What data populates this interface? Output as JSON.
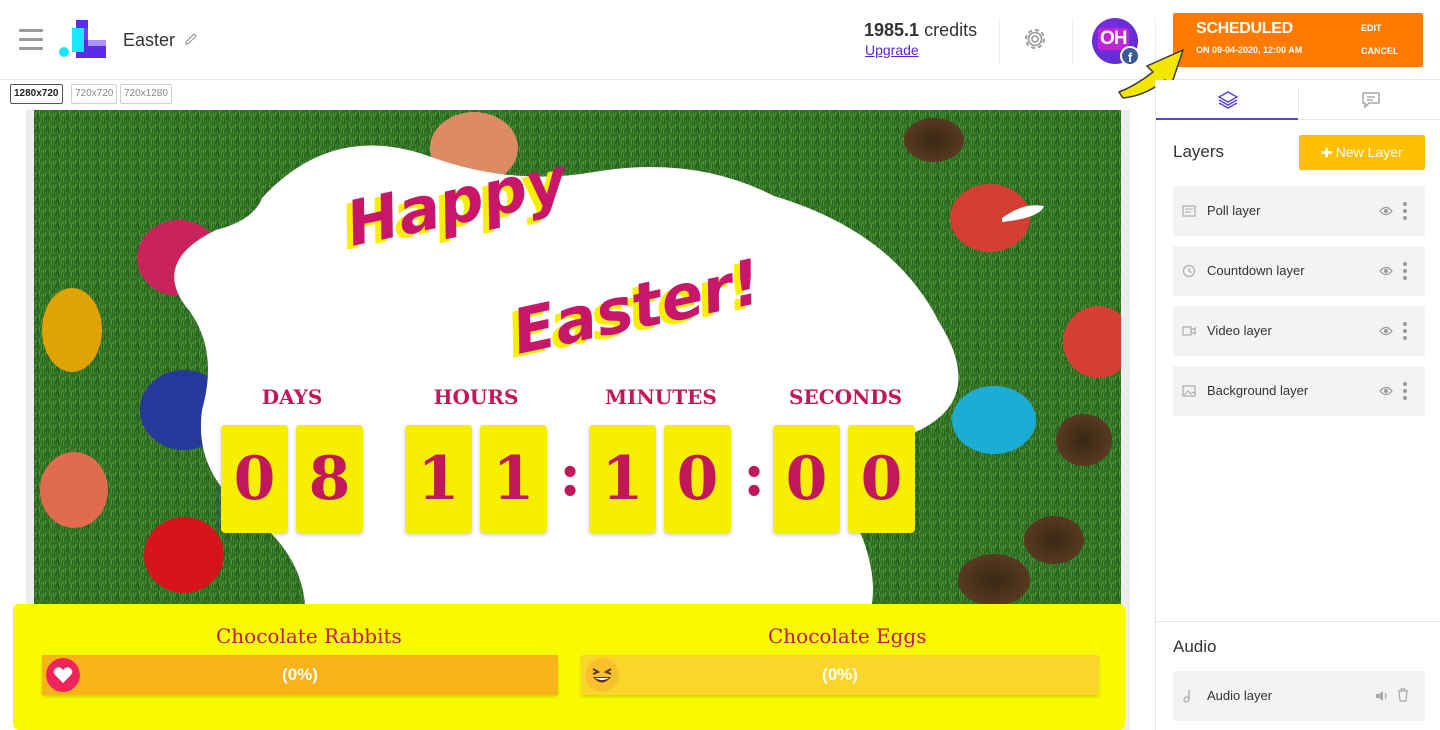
{
  "header": {
    "project_title": "Easter",
    "credits_value": "1985.1",
    "credits_label": "credits",
    "upgrade_label": "Upgrade",
    "avatar_initials": "OH",
    "avatar_badge": "f"
  },
  "schedule": {
    "status": "SCHEDULED",
    "when": "ON 09-04-2020, 12:00 AM",
    "edit_label": "EDIT",
    "cancel_label": "CANCEL"
  },
  "sizes": [
    "1280x720",
    "720x720",
    "720x1280"
  ],
  "canvas": {
    "headline_line1": "Happy",
    "headline_line2": "Easter!",
    "countdown": {
      "labels": [
        "DAYS",
        "HOURS",
        "MINUTES",
        "SECONDS"
      ],
      "digits": [
        "0",
        "8",
        "1",
        "1",
        "1",
        "0",
        "0",
        "0"
      ],
      "separator": ":"
    },
    "poll": {
      "options": [
        {
          "title": "Chocolate Rabbits",
          "percent": "(0%)",
          "icon": "heart-icon"
        },
        {
          "title": "Chocolate Eggs",
          "percent": "(0%)",
          "icon": "laughing-emoji-icon"
        }
      ]
    }
  },
  "panel": {
    "layers_title": "Layers",
    "new_layer_label": "New Layer",
    "layers": [
      {
        "name": "Poll layer",
        "icon": "poll-icon"
      },
      {
        "name": "Countdown layer",
        "icon": "clock-icon"
      },
      {
        "name": "Video layer",
        "icon": "video-icon"
      },
      {
        "name": "Background layer",
        "icon": "image-icon"
      }
    ],
    "audio_title": "Audio",
    "audio_layer": "Audio layer"
  },
  "colors": {
    "accent_orange": "#ff7a00",
    "accent_yellow": "#ffbf00",
    "brand_purple": "#5b3fd6",
    "easter_pink": "#c2185b",
    "easter_yellow": "#f9f900"
  }
}
